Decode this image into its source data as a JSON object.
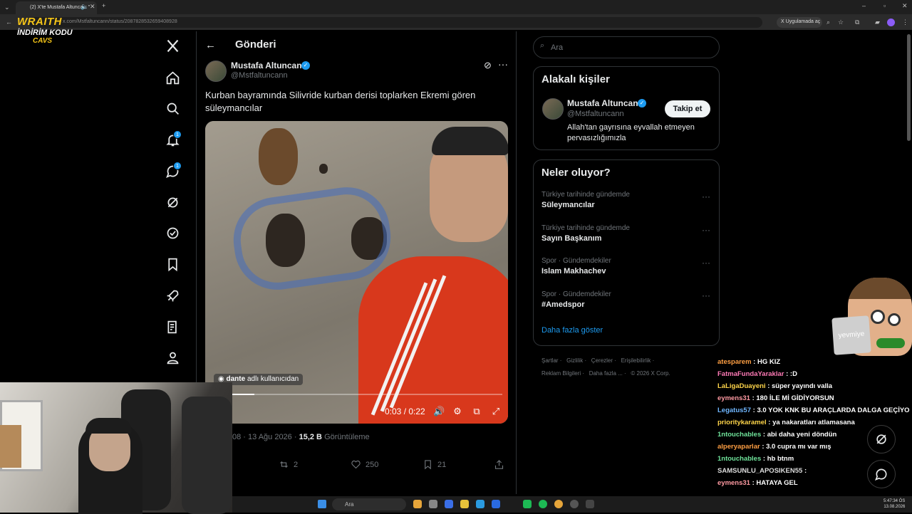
{
  "browser": {
    "tab_title": "(2) X'te Mustafa Altuncan: \"",
    "url": "x.com/Mstfaltuncann/status/2087828532659408928",
    "app_button": "Uygulamada aç"
  },
  "overlay": {
    "brand": "WRAITH",
    "line2": "İNDİRİM KODU",
    "line3": "CAVS",
    "sticker_text": "yevmiye"
  },
  "nav": {
    "notifications_badge": "1",
    "messages_badge": "1"
  },
  "post": {
    "header": "Gönderi",
    "author_name": "Mustafa Altuncan",
    "author_handle": "@Mstfaltuncann",
    "text": "Kurban bayramında Silivride kurban derisi toplarken Ekremi gören süleymancılar",
    "video_credit_user": "dante",
    "video_credit_suffix": "adlı kullanıcıdan",
    "video_time": "0:03 / 0:22",
    "video_progress": 0.14,
    "meta_time_date": "08 · 13 Ağu 2026 ·",
    "views_count": "15,2 B",
    "views_label": "Görüntüleme",
    "retweets": "2",
    "likes": "250",
    "bookmarks": "21"
  },
  "sidebar": {
    "search_placeholder": "Ara",
    "related_title": "Alakalı kişiler",
    "related_name": "Mustafa Altuncan",
    "related_handle": "@Mstfaltuncann",
    "follow_label": "Takip et",
    "related_bio": "Allah'tan gayrısına eyvallah etmeyen pervasızlığımızla",
    "trends_title": "Neler oluyor?",
    "trends": [
      {
        "context": "Türkiye tarihinde gündemde",
        "name": "Süleymancılar"
      },
      {
        "context": "Türkiye tarihinde gündemde",
        "name": "Sayın Başkanım"
      },
      {
        "context": "Spor · Gündemdekiler",
        "name": "Islam Makhachev"
      },
      {
        "context": "Spor · Gündemdekiler",
        "name": "#Amedspor"
      }
    ],
    "show_more": "Daha fazla göster",
    "footer_row1": [
      "Şartlar",
      "Gizlilik",
      "Çerezler",
      "Erişilebilirlik"
    ],
    "footer_row2": [
      "Reklam Bilgileri",
      "Daha fazla ...",
      "© 2026 X Corp."
    ]
  },
  "chat": [
    {
      "user": "atesparem",
      "msg": ": HG KIZ",
      "color": "#ff9f43"
    },
    {
      "user": "FatmaFundaYaraklar",
      "msg": ": :D",
      "color": "#ff7ab6"
    },
    {
      "user": "LaLigaDuayeni",
      "msg": ": süper yayındı valla",
      "color": "#ffd54a"
    },
    {
      "user": "eymens31",
      "msg": ": 180 İLE Mİ GİDİYORSUN",
      "color": "#ff9aa2"
    },
    {
      "user": "Legatus57",
      "msg": ": 3.0 YOK KNK BU ARAÇLARDA DALGA GEÇİYO",
      "color": "#6fb6ff"
    },
    {
      "user": "prioritykaramel",
      "msg": ": ya nakaratları atlamasana",
      "color": "#ffd54a"
    },
    {
      "user": "1ntouchables",
      "msg": ": abi daha yeni döndün",
      "color": "#6fe39a"
    },
    {
      "user": "alperyaparlar",
      "msg": ": 3.0 cupra mı var mış",
      "color": "#ff9f43"
    },
    {
      "user": "1ntouchables",
      "msg": ": hb btnm",
      "color": "#6fe39a"
    },
    {
      "user": "SAMSUNLU_APOSIKEN55",
      "msg": ":",
      "color": "#dddddd"
    },
    {
      "user": "eymens31",
      "msg": ": HATAYA GEL",
      "color": "#ff9aa2"
    }
  ],
  "taskbar": {
    "search_label": "Ara",
    "time": "5:47:34 ÖS",
    "date": "13.08.2026"
  }
}
